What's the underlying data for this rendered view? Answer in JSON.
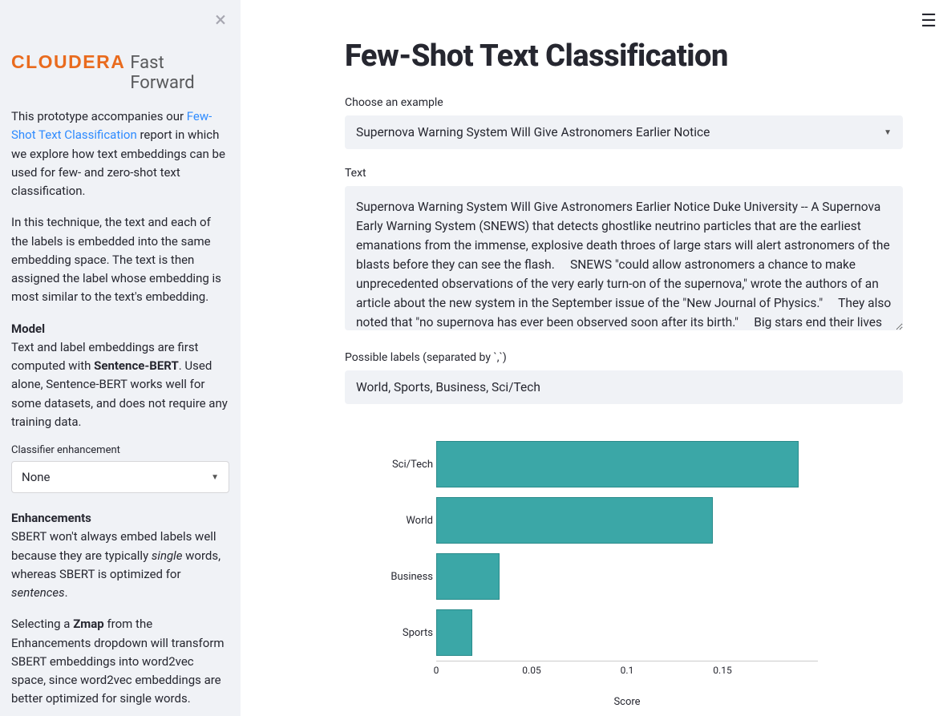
{
  "brand": {
    "name": "CLOUDERA",
    "product": "Fast Forward"
  },
  "sidebar": {
    "intro_pre": "This prototype accompanies our ",
    "intro_link": "Few-Shot Text Classification",
    "intro_post": " report in which we explore how text embeddings can be used for few- and zero-shot text classification.",
    "technique": "In this technique, the text and each of the labels is embedded into the same embedding space. The text is then assigned the label whose embedding is most similar to the text's embedding.",
    "model_head": "Model",
    "model_pre": "Text and label embeddings are first computed with ",
    "model_bold": "Sentence-BERT",
    "model_post": ". Used alone, Sentence-BERT works well for some datasets, and does not require any training data.",
    "enh_select_label": "Classifier enhancement",
    "enh_select_value": "None",
    "enh_head": "Enhancements",
    "enh_p1_pre": "SBERT won't always embed labels well because they are typically ",
    "enh_p1_em": "single",
    "enh_p1_mid": " words, whereas SBERT is optimized for ",
    "enh_p1_em2": "sentences",
    "enh_p1_end": ".",
    "enh_p2_pre": "Selecting a ",
    "enh_p2_bold": "Zmap",
    "enh_p2_post": " from the Enhancements dropdown will transform SBERT embeddings into word2vec space, since word2vec embeddings are better optimized for single words."
  },
  "main": {
    "title": "Few-Shot Text Classification",
    "example_label": "Choose an example",
    "example_selected": "Supernova Warning System Will Give Astronomers Earlier Notice",
    "text_label": "Text",
    "text_value": "Supernova Warning System Will Give Astronomers Earlier Notice Duke University -- A Supernova Early Warning System (SNEWS) that detects ghostlike neutrino particles that are the earliest emanations from the immense, explosive death throes of large stars will alert astronomers of the blasts before they can see the flash.     SNEWS \"could allow astronomers a chance to make unprecedented observations of the very early turn-on of the supernova,\" wrote the authors of an article about the new system in the September issue of the \"New Journal of Physics.\"     They also noted that \"no supernova has ever been observed soon after its birth.\"     Big stars end their lives in explosive gravitational collapses so complete",
    "labels_label": "Possible labels (separated by `,`)",
    "labels_value": "World, Sports, Business, Sci/Tech"
  },
  "chart_data": {
    "type": "bar",
    "orientation": "horizontal",
    "categories": [
      "Sci/Tech",
      "World",
      "Business",
      "Sports"
    ],
    "values": [
      0.19,
      0.145,
      0.033,
      0.019
    ],
    "xlabel": "Score",
    "xlim": [
      0,
      0.2
    ],
    "ticks": [
      0,
      0.05,
      0.1,
      0.15
    ]
  }
}
